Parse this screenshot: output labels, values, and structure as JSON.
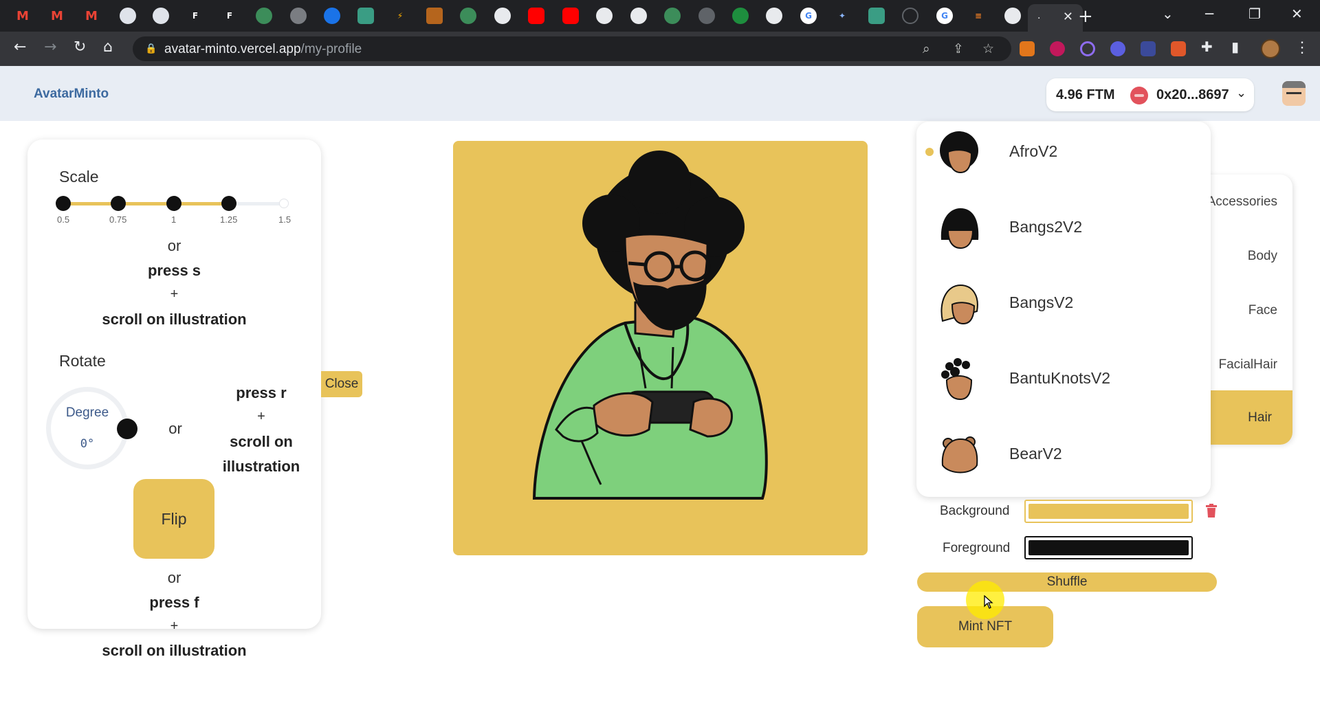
{
  "browser": {
    "url_host": "avatar-minto.vercel.app",
    "url_path": "/my-profile",
    "active_tab_title": "."
  },
  "app": {
    "brand": "AvatarMinto",
    "wallet": {
      "balance": "4.96 FTM",
      "address": "0x20...8697"
    }
  },
  "controls": {
    "scale": {
      "label": "Scale",
      "ticks": [
        "0.5",
        "0.75",
        "1",
        "1.25",
        "1.5"
      ],
      "value": 1.25
    },
    "scale_hint": {
      "or": "or",
      "key": "press s",
      "plus": "+",
      "action": "scroll on illustration"
    },
    "rotate": {
      "label": "Rotate",
      "dial_label": "Degree",
      "dial_value": "0°",
      "or": "or"
    },
    "rotate_hint": {
      "key": "press r",
      "plus": "+",
      "action_line1": "scroll on",
      "action_line2": "illustration"
    },
    "flip": {
      "label": "Flip"
    },
    "flip_hint": {
      "or": "or",
      "key": "press f",
      "plus": "+",
      "action": "scroll on illustration"
    },
    "close_label": "Close"
  },
  "categories": [
    "Accessories",
    "Body",
    "Face",
    "FacialHair",
    "Hair"
  ],
  "active_category": "Hair",
  "hair_options": [
    {
      "name": "AfroV2",
      "selected": true
    },
    {
      "name": "Bangs2V2",
      "selected": false
    },
    {
      "name": "BangsV2",
      "selected": false
    },
    {
      "name": "BantuKnotsV2",
      "selected": false
    },
    {
      "name": "BearV2",
      "selected": false
    }
  ],
  "colors": {
    "background_label": "Background",
    "background_value": "#E8C35A",
    "foreground_label": "Foreground",
    "foreground_value": "#111111"
  },
  "actions": {
    "shuffle": "Shuffle",
    "mint": "Mint NFT"
  }
}
